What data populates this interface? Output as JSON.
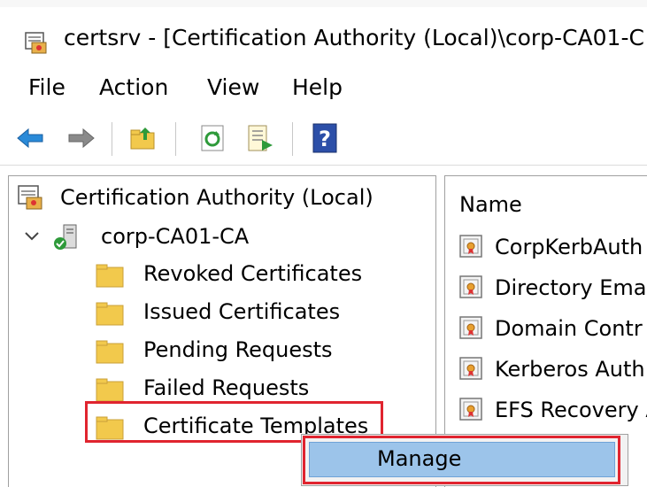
{
  "window": {
    "title": "certsrv - [Certification Authority (Local)\\corp-CA01-C"
  },
  "menu": [
    {
      "label": "File"
    },
    {
      "label": "Action"
    },
    {
      "label": "View"
    },
    {
      "label": "Help"
    }
  ],
  "toolbar": {
    "icons": [
      "back-arrow-icon",
      "forward-arrow-icon",
      "up-folder-icon",
      "refresh-icon",
      "export-list-icon",
      "help-icon"
    ]
  },
  "tree": {
    "root": "Certification Authority (Local)",
    "ca": "corp-CA01-CA",
    "folders": [
      "Revoked Certificates",
      "Issued Certificates",
      "Pending Requests",
      "Failed Requests",
      "Certificate Templates"
    ]
  },
  "list": {
    "column_name": "Name",
    "items": [
      "CorpKerbAuth",
      "Directory Ema",
      "Domain Contr",
      "Kerberos Auth",
      "EFS Recovery A"
    ]
  },
  "context_menu": {
    "items": [
      "Manage"
    ]
  },
  "colors": {
    "highlight_border": "#e0242f",
    "selection": "#9cc4ea",
    "folder": "#f2c94c"
  }
}
